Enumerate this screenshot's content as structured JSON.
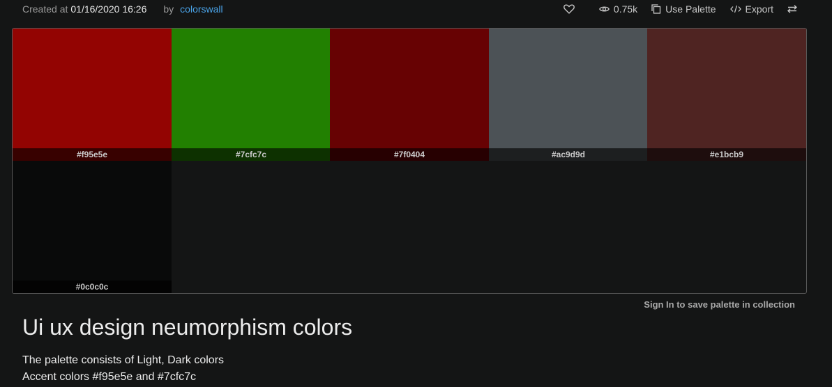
{
  "meta": {
    "created_label": "Created at",
    "created_date": "01/16/2020 16:26",
    "by_label": "by",
    "author": "colorswall"
  },
  "actions": {
    "like_icon": "heart-icon",
    "views_icon": "eye-icon",
    "views": "0.75k",
    "use_palette_icon": "copy-icon",
    "use_palette": "Use Palette",
    "export_icon": "code-icon",
    "export": "Export",
    "swap_icon": "swap-arrows-icon"
  },
  "palette": {
    "swatches": [
      {
        "hex": "#f95e5e",
        "color": "#930402"
      },
      {
        "hex": "#7cfc7c",
        "color": "#228001"
      },
      {
        "hex": "#7f0404",
        "color": "#670203"
      },
      {
        "hex": "#ac9d9d",
        "color": "#4c5256"
      },
      {
        "hex": "#e1bcb9",
        "color": "#4f2422"
      },
      {
        "hex": "#0c0c0c",
        "color": "#090a0a"
      }
    ]
  },
  "signin_text": "Sign In to save palette in collection",
  "title": "Ui ux design neumorphism colors",
  "description": {
    "line1": "The palette consists of Light, Dark colors",
    "line2": "Accent colors #f95e5e and #7cfc7c"
  }
}
